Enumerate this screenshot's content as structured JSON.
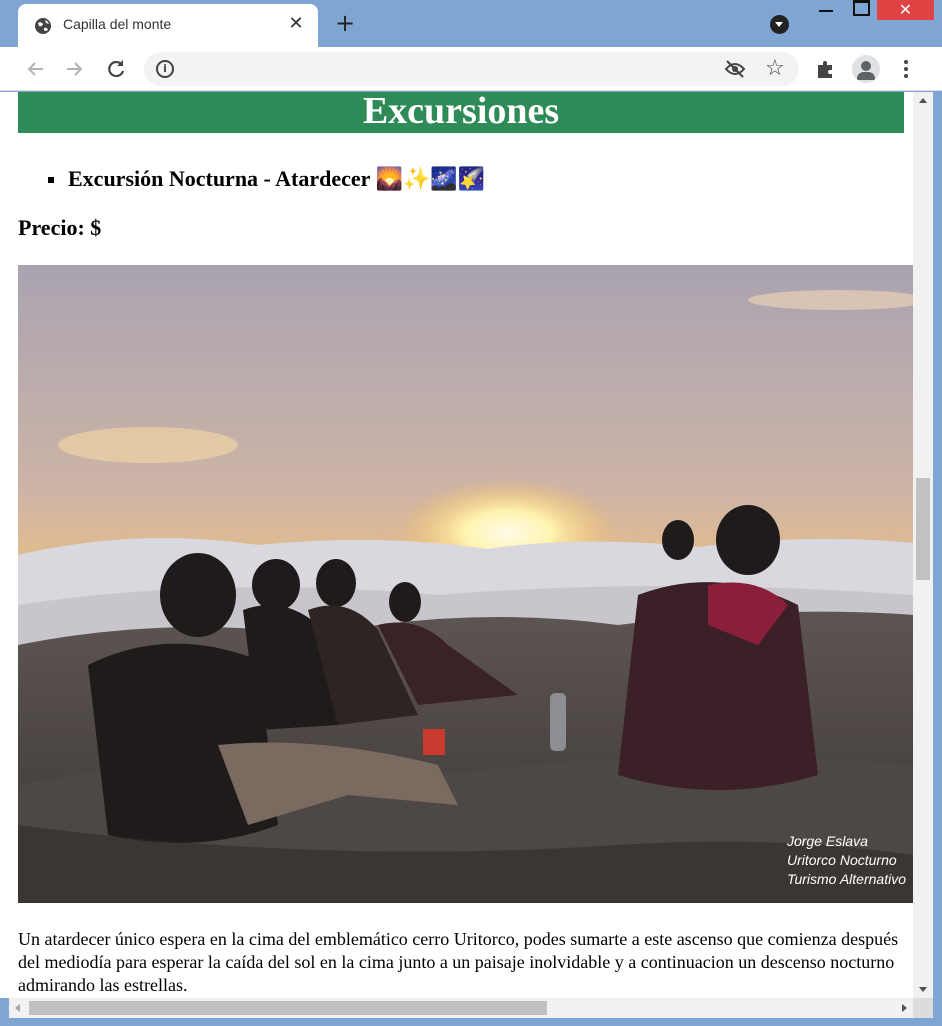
{
  "browser": {
    "tab_title": "Capilla del monte",
    "tab_close": "✕",
    "new_tab": "+",
    "window_close": "✕"
  },
  "page": {
    "heading": "Excursiones",
    "list_item": "Excursión Nocturna - Atardecer 🌄✨🌌🌠",
    "price_label": "Precio: $",
    "photo_credit": [
      "Jorge Eslava",
      "Uritorco Nocturno",
      "Turismo Alternativo"
    ],
    "description": "Un atardecer único espera en la cima del emblemático cerro Uritorco, podes sumarte a este ascenso que comienza después del mediodía para esperar la caída del sol en la cima junto a un paisaje inolvidable y a continuacion un descenso nocturno admirando las estrellas."
  },
  "colors": {
    "banner": "#2e8b57",
    "titlebar": "#7fa6d3",
    "close_button": "#e04343"
  }
}
